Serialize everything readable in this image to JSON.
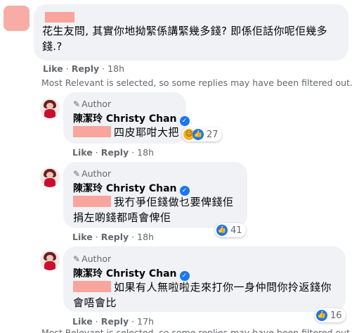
{
  "top_comment": {
    "text": "花生友問, 其實你地拗緊係講緊幾多錢? 即係佢話你呢佢幾多錢.?",
    "like": "Like",
    "reply": "Reply",
    "time": "18h"
  },
  "filter_note": "Most Relevant is selected, so some replies may have been filtered out.",
  "replies": [
    {
      "author_tag": "Author",
      "name": "陳潔玲 Christy Chan",
      "text": "四皮耶咁大把",
      "reaction_count": "27",
      "like": "Like",
      "reply": "Reply",
      "time": "18h"
    },
    {
      "author_tag": "Author",
      "name": "陳潔玲 Christy Chan",
      "mention_first_char": "?",
      "text": "我冇爭佢錢做乜要俾錢佢捐左啲錢都唔會俾佢",
      "reaction_count": "41",
      "like": "Like",
      "reply": "Reply",
      "time": "18h"
    },
    {
      "author_tag": "Author",
      "name": "陳潔玲 Christy Chan",
      "mention_first_char": "?",
      "text": "如果有人無啦啦走來打你一身仲問你拎返錢你會唔會比",
      "reaction_count": "16",
      "like": "Like",
      "reply": "Reply",
      "time": "17h"
    }
  ],
  "bottom_note": "Most Relevant is selected, so some replies may have been filtered out.",
  "icons": {
    "verified": "verified-badge-icon",
    "pencil": "pencil-icon",
    "haha": "haha-reaction-icon",
    "like": "like-reaction-icon"
  },
  "colors": {
    "bubble": "#f0f2f5",
    "meta": "#65676b",
    "verified": "#1877f2",
    "redaction": "#f7a59d"
  }
}
